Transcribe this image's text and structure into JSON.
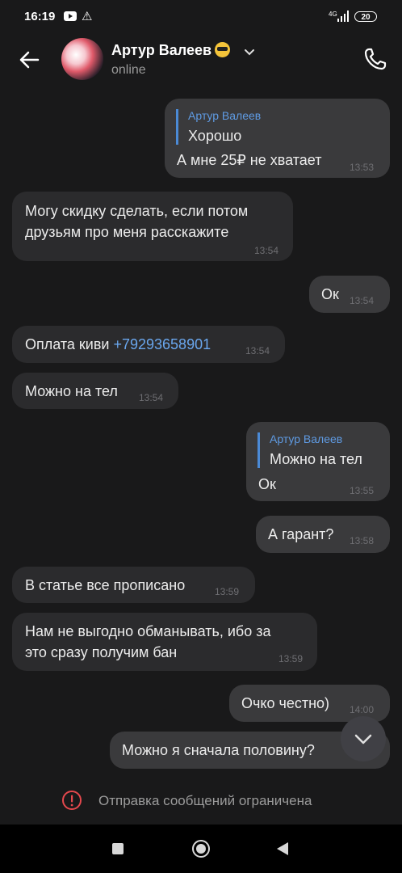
{
  "status_bar": {
    "time": "16:19",
    "network": "4G",
    "battery": "20"
  },
  "header": {
    "name": "Артур Валеев",
    "status": "online"
  },
  "messages": [
    {
      "dir": "out",
      "reply_name": "Артур Валеев",
      "reply_text": "Хорошо",
      "text": "А мне 25₽ не хватает",
      "time": "13:53"
    },
    {
      "dir": "in",
      "line1": "Могу скидку сделать, если потом",
      "line2": "друзьям про меня расскажите",
      "time": "13:54"
    },
    {
      "dir": "out",
      "text": "Ок",
      "time": "13:54"
    },
    {
      "dir": "in",
      "text": "Оплата киви ",
      "link": "+79293658901",
      "time": "13:54"
    },
    {
      "dir": "in",
      "text": "Можно на тел",
      "time": "13:54"
    },
    {
      "dir": "out",
      "reply_name": "Артур Валеев",
      "reply_text": "Можно на тел",
      "text": "Ок",
      "time": "13:55"
    },
    {
      "dir": "out",
      "text": "А гарант?",
      "time": "13:58"
    },
    {
      "dir": "in",
      "text": "В статье все прописано",
      "time": "13:59"
    },
    {
      "dir": "in",
      "line1": "Нам не выгодно обманывать, ибо за",
      "line2": "это сразу получим бан",
      "time": "13:59"
    },
    {
      "dir": "out",
      "text": "Очко честно)",
      "time": "14:00"
    },
    {
      "dir": "out",
      "text": "Можно я сначала половину?",
      "time": ""
    }
  ],
  "restricted_notice": "Отправка сообщений ограничена",
  "colors": {
    "background": "#19191a",
    "incoming": "#2b2b2d",
    "outgoing": "#3a3a3c",
    "accent": "#5f9be3",
    "link": "#6aa7ee"
  }
}
